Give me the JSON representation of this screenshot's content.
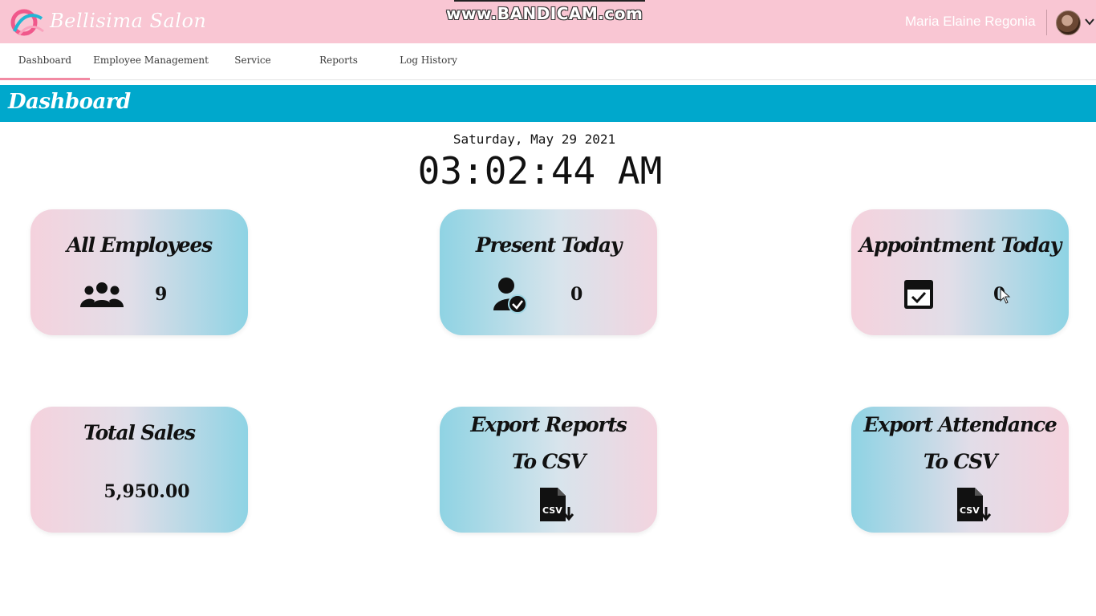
{
  "app": {
    "brand": "Bellisima Salon",
    "watermark": "www.BANDICAM.com",
    "user_name": "Maria Elaine Regonia"
  },
  "nav": {
    "tabs": [
      {
        "label": "Dashboard",
        "active": true
      },
      {
        "label": "Employee Management",
        "active": false
      },
      {
        "label": "Service",
        "active": false
      },
      {
        "label": "Reports",
        "active": false
      },
      {
        "label": "Log History",
        "active": false
      }
    ]
  },
  "page": {
    "title": "Dashboard",
    "date": "Saturday, May 29 2021",
    "time": "03:02:44 AM"
  },
  "cards": {
    "all_employees": {
      "title": "All Employees",
      "value": "9",
      "icon": "users-icon"
    },
    "present_today": {
      "title": "Present Today",
      "value": "0",
      "icon": "user-check-icon"
    },
    "appointment_today": {
      "title": "Appointment Today",
      "value": "0",
      "icon": "calendar-check-icon"
    },
    "total_sales": {
      "title": "Total Sales",
      "value": "5,950.00"
    },
    "export_reports": {
      "title_line1": "Export Reports",
      "title_line2": "To CSV",
      "icon": "csv-download-icon"
    },
    "export_attendance": {
      "title_line1": "Export Attendance",
      "title_line2": "To CSV",
      "icon": "csv-download-icon"
    }
  },
  "colors": {
    "topbar": "#f9c6d3",
    "banner": "#00a8cc",
    "active_tab_underline": "#f28aa3"
  }
}
